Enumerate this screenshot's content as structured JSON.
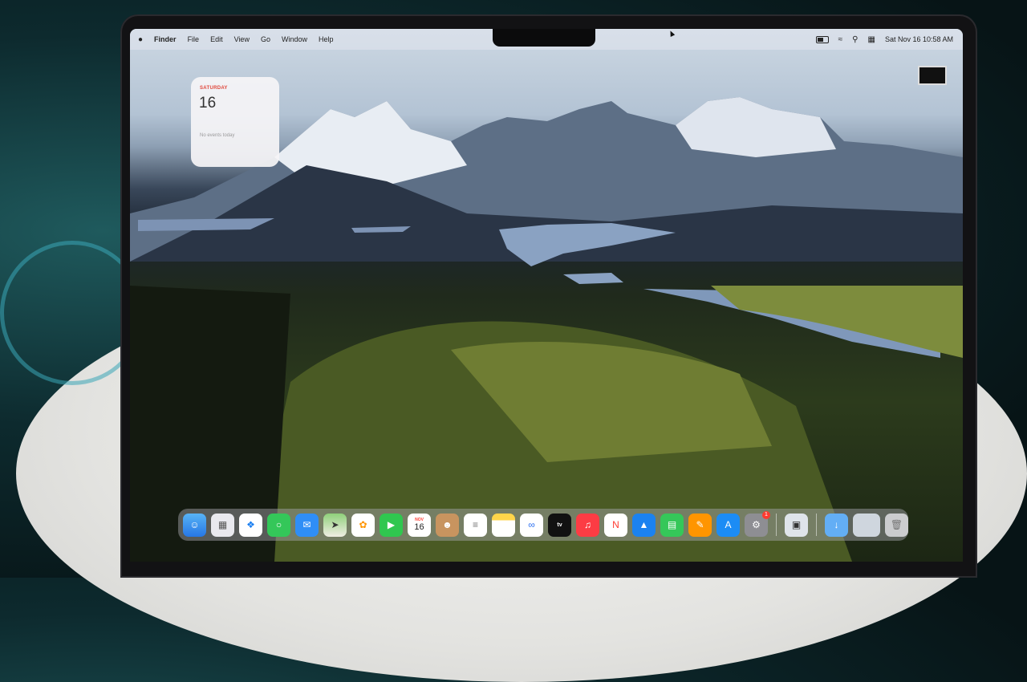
{
  "menubar": {
    "apple": "",
    "items": [
      "Finder",
      "File",
      "Edit",
      "View",
      "Go",
      "Window",
      "Help"
    ],
    "status_icons": [
      "battery-icon",
      "wifi-icon",
      "search-icon",
      "control-center-icon"
    ],
    "datetime": "Sat Nov 16  10:58 AM"
  },
  "widget": {
    "day": "SATURDAY",
    "date": "16",
    "events": "No events today"
  },
  "dock": {
    "calendar_month": "NOV",
    "calendar_day": "16",
    "tv_label": "tv",
    "settings_badge": "1",
    "apps": [
      "Finder",
      "Launchpad",
      "Safari",
      "Messages",
      "Mail",
      "Maps",
      "Photos",
      "FaceTime",
      "Calendar",
      "Contacts",
      "Reminders",
      "Notes",
      "Freeform",
      "TV",
      "Music",
      "News",
      "Keynote",
      "Numbers",
      "Pages",
      "App Store",
      "System Settings",
      "Preview",
      "Downloads",
      "Trash"
    ]
  }
}
